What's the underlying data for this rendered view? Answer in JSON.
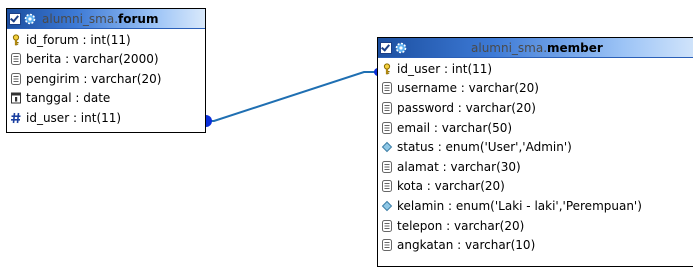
{
  "tables": {
    "forum": {
      "schema": "alumni_sma.",
      "name": "forum",
      "fields": [
        {
          "label": "id_forum : int(11)",
          "icon": "key-icon"
        },
        {
          "label": "berita : varchar(2000)",
          "icon": "text-field-icon"
        },
        {
          "label": "pengirim : varchar(20)",
          "icon": "text-field-icon"
        },
        {
          "label": "tanggal : date",
          "icon": "date-field-icon"
        },
        {
          "label": "id_user : int(11)",
          "icon": "hash-icon"
        }
      ]
    },
    "member": {
      "schema": "alumni_sma.",
      "name": "member",
      "fields": [
        {
          "label": "id_user : int(11)",
          "icon": "key-icon"
        },
        {
          "label": "username : varchar(20)",
          "icon": "text-field-icon"
        },
        {
          "label": "password : varchar(20)",
          "icon": "text-field-icon"
        },
        {
          "label": "email : varchar(50)",
          "icon": "text-field-icon"
        },
        {
          "label": "status : enum('User','Admin')",
          "icon": "enum-diamond-icon"
        },
        {
          "label": "alamat : varchar(30)",
          "icon": "text-field-icon"
        },
        {
          "label": "kota : varchar(20)",
          "icon": "text-field-icon"
        },
        {
          "label": "kelamin : enum('Laki - laki','Perempuan')",
          "icon": "enum-diamond-icon"
        },
        {
          "label": "telepon : varchar(20)",
          "icon": "text-field-icon"
        },
        {
          "label": "angkatan : varchar(10)",
          "icon": "text-field-icon"
        }
      ]
    }
  },
  "relation": {
    "from": "forum.id_user",
    "to": "member.id_user"
  },
  "colors": {
    "title_dark": "#1c4fa0",
    "title_light": "#d9e9fb",
    "connector": "#1f6fb2",
    "key_gold": "#d9a520",
    "hash_blue": "#1a3fa0"
  }
}
